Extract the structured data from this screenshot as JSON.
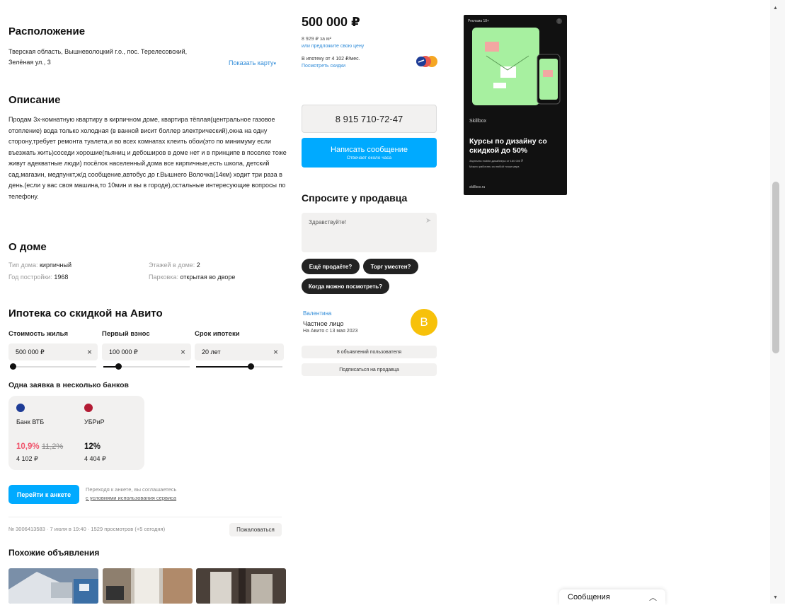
{
  "location": {
    "title": "Расположение",
    "address_line1": "Тверская область, Вышневолоцкий г.о., пос. Терелесовский,",
    "address_line2": "Зелёная ул., 3",
    "map_link": "Показать карту"
  },
  "description": {
    "title": "Описание",
    "text": "Продам 3х-комнатную квартиру в кирпичном доме, квартира тёплая(центральное газовое отопление) вода только холодная (в ванной висит боллер электрический),окна на одну сторону,требует ремонта туалета,и во всех комнатах клеить обои(это по минимуму если въезжать жить)соседи хорошие(пьяниц и дебоширов в доме нет и в принципе в поселке тоже живут адекватные люди) посёлок населенный,дома все кирпичные,есть школа, детский сад,магазин, медпункт,ж/д сообщение,автобус до г.Вышнего Волочка(14км) ходит три раза в день.(если у вас своя машина,то 10мин и вы в городе),остальные интересующие вопросы по телефону."
  },
  "house": {
    "title": "О доме",
    "type_label": "Тип дома:",
    "type_value": "кирпичный",
    "year_label": "Год постройки:",
    "year_value": "1968",
    "floors_label": "Этажей в доме:",
    "floors_value": "2",
    "parking_label": "Парковка:",
    "parking_value": "открытая во дворе"
  },
  "mortgage": {
    "title": "Ипотека со скидкой на Авито",
    "cost_label": "Стоимость жилья",
    "cost_value": "500 000 ₽",
    "down_label": "Первый взнос",
    "down_value": "100 000 ₽",
    "term_label": "Срок ипотеки",
    "term_value": "20 лет",
    "clear_icon": "×",
    "cost_slider_fraction": 0.0,
    "down_slider_fraction": 0.15,
    "term_slider_fraction": 0.65,
    "banks_title": "Одна заявка в несколько банков",
    "banks": [
      {
        "name": "Банк ВТБ",
        "rate": "10,9%",
        "old_rate": "11,2%",
        "payment": "4 102 ₽",
        "logo_color": "#1e3c96",
        "rate_color": "#f0556c"
      },
      {
        "name": "УБРиР",
        "rate": "12%",
        "old_rate": "",
        "payment": "4 404 ₽",
        "logo_color": "#b31b34",
        "rate_color": "#111111"
      }
    ],
    "apply_button": "Перейти к анкете",
    "terms_line1": "Переходя к анкете, вы соглашаетесь",
    "terms_line2": "с условиями использования сервиса"
  },
  "listing_meta": {
    "info": "№ 3006413583 · 7 июля в 19:40 · 1529 просмотров (+5 сегодня)",
    "report_button": "Пожаловаться"
  },
  "similar": {
    "title": "Похожие объявления"
  },
  "sidebar": {
    "price": "500 000 ₽",
    "price_per_m2": "8 929 ₽ за м²",
    "offer_link": "или предложите свою цену",
    "mortgage_line": "В ипотеку от 4 102 ₽/мес.",
    "discounts_link": "Посмотреть скидки",
    "phone": "8 915 710-72-47",
    "write_button": "Написать сообщение",
    "write_sub": "Отвечает около часа",
    "ask_title": "Спросите у продавца",
    "ask_placeholder": "Здравствуйте!",
    "chips": [
      "Ещё продаёте?",
      "Торг уместен?",
      "Когда можно посмотреть?"
    ],
    "seller_name": "Валентина",
    "seller_type": "Частное лицо",
    "seller_since": "На Авито с 13 мая 2023",
    "seller_initial": "В",
    "user_ads_button": "8 объявлений пользователя",
    "subscribe_button": "Подписаться на продавца"
  },
  "ad": {
    "badge": "Реклама  18+",
    "brand": "Skillbox",
    "headline": "Курсы по дизайну со скидкой до 50%",
    "bullet1": "Зарплата mobile-дизайнера от 160 000 ₽",
    "bullet2": "Можно работать из любой точки мира",
    "site": "skillbox.ru",
    "bg_color": "#a7f0a0"
  },
  "chat_bar": {
    "label": "Сообщения"
  },
  "colors": {
    "accent_blue": "#00aaff",
    "link_blue": "#2f8bd8",
    "seller_avatar": "#f7c10a"
  }
}
